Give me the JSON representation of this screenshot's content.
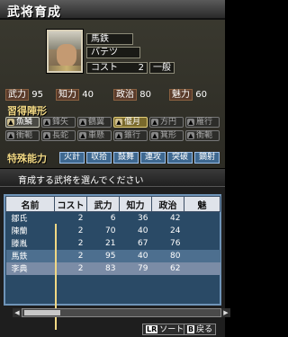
{
  "top": {
    "title": "武将育成",
    "officer": {
      "name": "馬鉄",
      "reading": "バテツ",
      "cost_label": "コスト",
      "cost_value": "2",
      "rank": "一般"
    },
    "stats": [
      {
        "label": "武力",
        "value": "95"
      },
      {
        "label": "知力",
        "value": "40"
      },
      {
        "label": "政治",
        "value": "80"
      },
      {
        "label": "魅力",
        "value": "60"
      }
    ],
    "formations_heading": "習得陣形",
    "formations": [
      {
        "label": "魚鱗",
        "state": "on"
      },
      {
        "label": "鋒矢",
        "state": "off"
      },
      {
        "label": "鶴翼",
        "state": "off"
      },
      {
        "label": "偃月",
        "state": "selected"
      },
      {
        "label": "方円",
        "state": "off"
      },
      {
        "label": "雁行",
        "state": "off"
      },
      {
        "label": "衝軛",
        "state": "off"
      },
      {
        "label": "長蛇",
        "state": "off"
      },
      {
        "label": "車懸",
        "state": "off"
      },
      {
        "label": "錐行",
        "state": "off"
      },
      {
        "label": "箕形",
        "state": "off"
      },
      {
        "label": "衡軛",
        "state": "off"
      }
    ],
    "skills_heading": "特殊能力",
    "skills": [
      "火計",
      "収拾",
      "鼓舞",
      "連攻",
      "突破",
      "鏑射"
    ]
  },
  "bottom": {
    "prompt": "育成する武将を選んでください",
    "columns": [
      "名前",
      "コスト",
      "武力",
      "知力",
      "政治",
      "魅"
    ],
    "rows": [
      {
        "name": "鄒氏",
        "cost": "2",
        "war": "6",
        "int": "36",
        "pol": "42",
        "state": "normal"
      },
      {
        "name": "陳蘭",
        "cost": "2",
        "war": "70",
        "int": "40",
        "pol": "24",
        "state": "normal"
      },
      {
        "name": "滕胤",
        "cost": "2",
        "war": "21",
        "int": "67",
        "pol": "76",
        "state": "normal"
      },
      {
        "name": "馬鉄",
        "cost": "2",
        "war": "95",
        "int": "40",
        "pol": "80",
        "state": "selected"
      },
      {
        "name": "李典",
        "cost": "2",
        "war": "83",
        "int": "79",
        "pol": "62",
        "state": "highlight"
      }
    ],
    "commands": [
      {
        "key": "LR",
        "label": "ソート"
      },
      {
        "key": "B",
        "label": "戻る"
      }
    ]
  }
}
